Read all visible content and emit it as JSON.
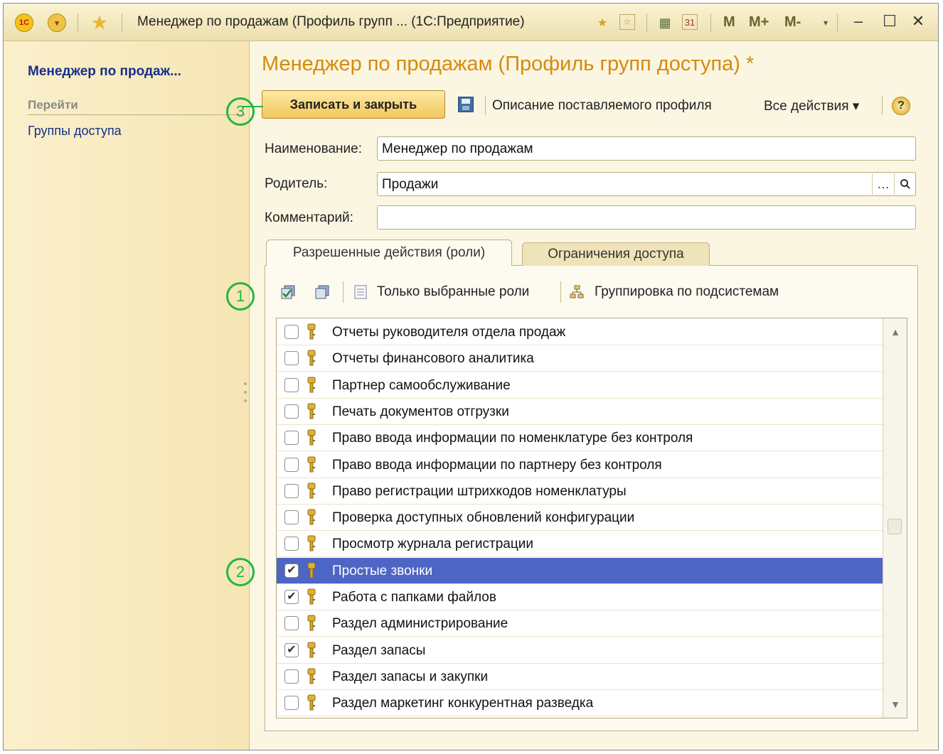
{
  "titlebar": {
    "logo": "1С",
    "title": "Менеджер по продажам (Профиль групп ... (1С:Предприятие)",
    "m_buttons": [
      "M",
      "M+",
      "M-"
    ]
  },
  "sidebar": {
    "title": "Менеджер по продаж...",
    "goto_label": "Перейти",
    "links": [
      "Группы доступа"
    ]
  },
  "form": {
    "title": "Менеджер по продажам (Профиль групп доступа) *",
    "toolbar": {
      "save_close": "Записать и закрыть",
      "description": "Описание поставляемого профиля",
      "all_actions": "Все действия ▾",
      "help": "?"
    },
    "fields": {
      "name_label": "Наименование:",
      "name_value": "Менеджер по продажам",
      "parent_label": "Родитель:",
      "parent_value": "Продажи",
      "comment_label": "Комментарий:",
      "comment_value": ""
    },
    "tabs": [
      {
        "label": "Разрешенные действия (роли)",
        "active": true
      },
      {
        "label": "Ограничения доступа",
        "active": false
      }
    ],
    "roles_toolbar": {
      "only_selected": "Только выбранные роли",
      "group_by_subsystem": "Группировка по подсистемам"
    },
    "roles": [
      {
        "label": "Отчеты руководителя отдела продаж",
        "checked": false,
        "selected": false
      },
      {
        "label": "Отчеты финансового аналитика",
        "checked": false,
        "selected": false
      },
      {
        "label": "Партнер самообслуживание",
        "checked": false,
        "selected": false
      },
      {
        "label": "Печать документов отгрузки",
        "checked": false,
        "selected": false
      },
      {
        "label": "Право ввода информации по номенклатуре без контроля",
        "checked": false,
        "selected": false
      },
      {
        "label": "Право ввода информации по партнеру без контроля",
        "checked": false,
        "selected": false
      },
      {
        "label": "Право регистрации штрихкодов номенклатуры",
        "checked": false,
        "selected": false
      },
      {
        "label": "Проверка доступных обновлений конфигурации",
        "checked": false,
        "selected": false
      },
      {
        "label": "Просмотр журнала регистрации",
        "checked": false,
        "selected": false
      },
      {
        "label": "Простые звонки",
        "checked": true,
        "selected": true
      },
      {
        "label": "Работа с папками файлов",
        "checked": true,
        "selected": false
      },
      {
        "label": "Раздел администрирование",
        "checked": false,
        "selected": false
      },
      {
        "label": "Раздел запасы",
        "checked": true,
        "selected": false
      },
      {
        "label": "Раздел запасы и закупки",
        "checked": false,
        "selected": false
      },
      {
        "label": "Раздел маркетинг конкурентная разведка",
        "checked": false,
        "selected": false
      }
    ]
  },
  "callouts": [
    "1",
    "2",
    "3"
  ],
  "colors": {
    "title_orange": "#d68a0c",
    "link_blue": "#16308a",
    "selection_blue": "#4d65c5",
    "callout_green": "#27b53d",
    "background": "#fbf6e2"
  }
}
